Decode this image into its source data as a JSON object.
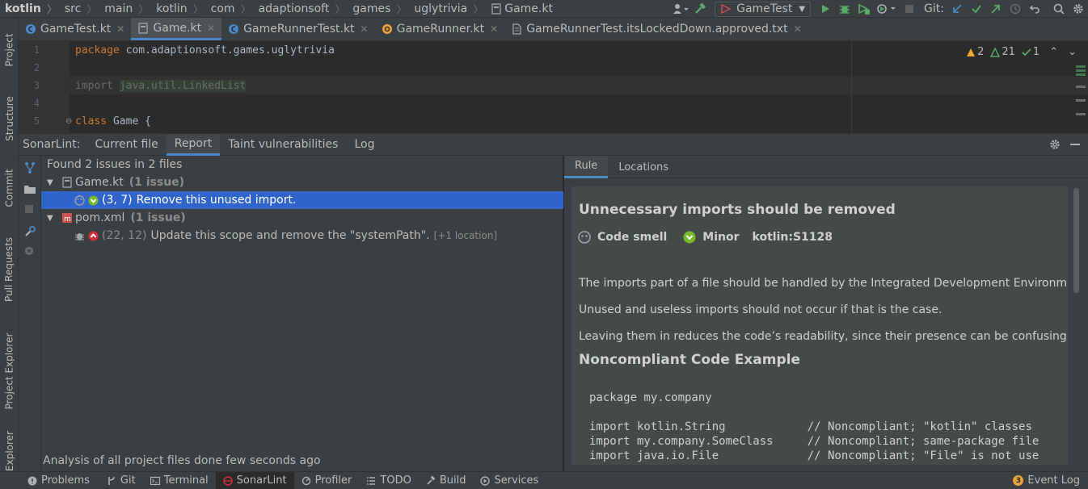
{
  "breadcrumb": [
    "kotlin",
    "src",
    "main",
    "kotlin",
    "com",
    "adaptionsoft",
    "games",
    "uglytrivia",
    "Game.kt"
  ],
  "toolbar": {
    "run_config": "GameTest",
    "git_label": "Git:"
  },
  "left_stripe": [
    "Project",
    "Structure",
    "Commit",
    "Pull Requests",
    "Project Explorer",
    "Explorer"
  ],
  "tabs": [
    {
      "label": "GameTest.kt"
    },
    {
      "label": "Game.kt"
    },
    {
      "label": "GameRunnerTest.kt"
    },
    {
      "label": "GameRunner.kt"
    },
    {
      "label": "GameRunnerTest.itsLockedDown.approved.txt"
    }
  ],
  "editor": {
    "line_numbers": [
      "1",
      "2",
      "3",
      "4",
      "5"
    ],
    "line1_kw": "package",
    "line1_rest": " com.adaptionsoft.games.uglytrivia",
    "line3_kw": "import",
    "line3_pkg": "java.util.",
    "line3_class": "LinkedList",
    "line5_kw": "class",
    "line5_rest": " Game {",
    "warnings": "2",
    "weak_warnings": "21",
    "typos": "1"
  },
  "sonarlint": {
    "title": "SonarLint:",
    "tabs": [
      "Current file",
      "Report",
      "Taint vulnerabilities",
      "Log"
    ],
    "summary": "Found 2 issues in 2 files",
    "files": [
      {
        "name": "Game.kt",
        "count": "(1 issue)",
        "issue_loc": "(3, 7)",
        "issue_msg": "Remove this unused import."
      },
      {
        "name": "pom.xml",
        "count": "(1 issue)",
        "issue_loc": "(22, 12)",
        "issue_msg": "Update this scope and remove the \"systemPath\".",
        "extra": "[+1 location]"
      }
    ],
    "status": "Analysis of all project files done few seconds ago"
  },
  "rule": {
    "tabs": [
      "Rule",
      "Locations"
    ],
    "title": "Unnecessary imports should be removed",
    "type": "Code smell",
    "severity": "Minor",
    "key": "kotlin:S1128",
    "paragraphs": [
      "The imports part of a file should be handled by the Integrated Development Environment",
      "Unused and useless imports should not occur if that is the case.",
      "Leaving them in reduces the code’s readability, since their presence can be confusing."
    ],
    "noncompliant_title": "Noncompliant Code Example",
    "code_lines": [
      "package my.company",
      "",
      "import kotlin.String            // Noncompliant; \"kotlin\" classes",
      "import my.company.SomeClass     // Noncompliant; same-package file",
      "import java.io.File             // Noncompliant; \"File\" is not use"
    ]
  },
  "bottom_tabs": [
    "Problems",
    "Git",
    "Terminal",
    "SonarLint",
    "Profiler",
    "TODO",
    "Build",
    "Services"
  ],
  "event_log": {
    "count": "3",
    "label": "Event Log"
  }
}
